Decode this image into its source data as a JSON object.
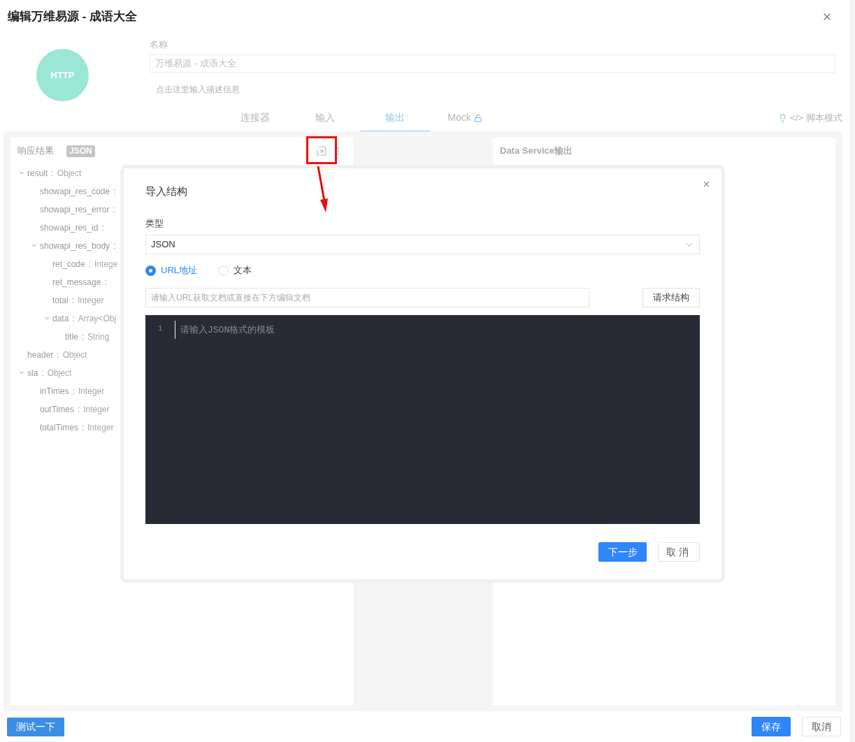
{
  "dialog": {
    "title": "编辑万维易源 - 成语大全"
  },
  "connector": {
    "badge": "HTTP"
  },
  "name_field": {
    "label": "名称",
    "value": "万维易源 - 成语大全"
  },
  "description": {
    "placeholder": "点击这里输入描述信息"
  },
  "tabs": [
    {
      "label": "连接器",
      "selected": false,
      "locked": false
    },
    {
      "label": "输入",
      "selected": false,
      "locked": false
    },
    {
      "label": "输出",
      "selected": true,
      "locked": false
    },
    {
      "label": "Mock",
      "selected": false,
      "locked": true
    }
  ],
  "script_mode": {
    "code_glyph": "</>",
    "label": "脚本模式"
  },
  "response_panel": {
    "title": "响应结果",
    "format_badge": "JSON",
    "tree": [
      {
        "key": "result",
        "colon": ":",
        "type": "Object",
        "expanded": true,
        "children": [
          {
            "key": "showapi_res_code",
            "colon": ":"
          },
          {
            "key": "showapi_res_error",
            "colon": ":"
          },
          {
            "key": "showapi_res_id",
            "colon": ":"
          },
          {
            "key": "showapi_res_body",
            "colon": ":",
            "expanded": true,
            "children": [
              {
                "key": "ret_code",
                "colon": ":",
                "type": "Intege"
              },
              {
                "key": "ret_message",
                "colon": ":"
              },
              {
                "key": "total",
                "colon": ":",
                "type": "Integer"
              },
              {
                "key": "data",
                "colon": ":",
                "type": "Array<Obj",
                "expanded": true,
                "children": [
                  {
                    "key": "title",
                    "colon": ":",
                    "type": "String"
                  }
                ]
              }
            ]
          }
        ]
      },
      {
        "key": "header",
        "colon": ":",
        "type": "Object"
      },
      {
        "key": "sla",
        "colon": ":",
        "type": "Object",
        "expanded": true,
        "children": [
          {
            "key": "inTimes",
            "colon": ":",
            "type": "Integer"
          },
          {
            "key": "outTimes",
            "colon": ":",
            "type": "Integer"
          },
          {
            "key": "totalTimes",
            "colon": ":",
            "type": "Integer"
          }
        ]
      }
    ]
  },
  "output_panel": {
    "title": "Data Service输出"
  },
  "import_modal": {
    "title": "导入结构",
    "type_label": "类型",
    "type_value": "JSON",
    "source_options": [
      {
        "label": "URL地址",
        "selected": true
      },
      {
        "label": "文本",
        "selected": false
      }
    ],
    "url_field": {
      "placeholder": "请输入URL获取文档或直接在下方编辑文档"
    },
    "fetch_button": "请求结构",
    "editor": {
      "line_numbers": [
        "1"
      ],
      "placeholder": "请输入JSON格式的模板"
    },
    "buttons": [
      {
        "label": "下一步",
        "kind": "primary"
      },
      {
        "label": "取消",
        "kind": "default"
      }
    ]
  },
  "footer": {
    "test_button": "测试一下",
    "buttons": [
      {
        "label": "保存",
        "kind": "primary"
      },
      {
        "label": "取消",
        "kind": "default"
      }
    ]
  }
}
